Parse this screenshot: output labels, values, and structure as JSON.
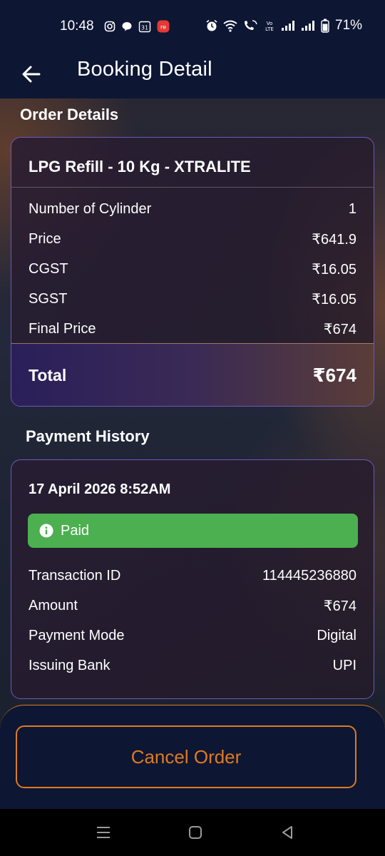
{
  "status_bar": {
    "time": "10:48",
    "battery": "71%"
  },
  "app_bar": {
    "title": "Booking Detail",
    "back_icon": "arrow-left-icon"
  },
  "order": {
    "section_title": "Order Details",
    "product": "LPG Refill - 10 Kg - XTRALITE",
    "rows": [
      {
        "label": "Number of Cylinder",
        "value": "1"
      },
      {
        "label": "Price",
        "value": "₹641.9"
      },
      {
        "label": "CGST",
        "value": "₹16.05"
      },
      {
        "label": "SGST",
        "value": "₹16.05"
      },
      {
        "label": "Final Price",
        "value": "₹674"
      }
    ],
    "total_label": "Total",
    "total_value": "₹674"
  },
  "payment": {
    "section_title": "Payment History",
    "date": "17 April 2026 8:52AM",
    "status": "Paid",
    "status_color": "#4caf50",
    "rows": [
      {
        "label": "Transaction ID",
        "value": "114445236880"
      },
      {
        "label": "Amount",
        "value": "₹674"
      },
      {
        "label": "Payment Mode",
        "value": "Digital"
      },
      {
        "label": "Issuing Bank",
        "value": "UPI"
      }
    ]
  },
  "actions": {
    "cancel_label": "Cancel Order",
    "accent_color": "#e07a1f"
  }
}
